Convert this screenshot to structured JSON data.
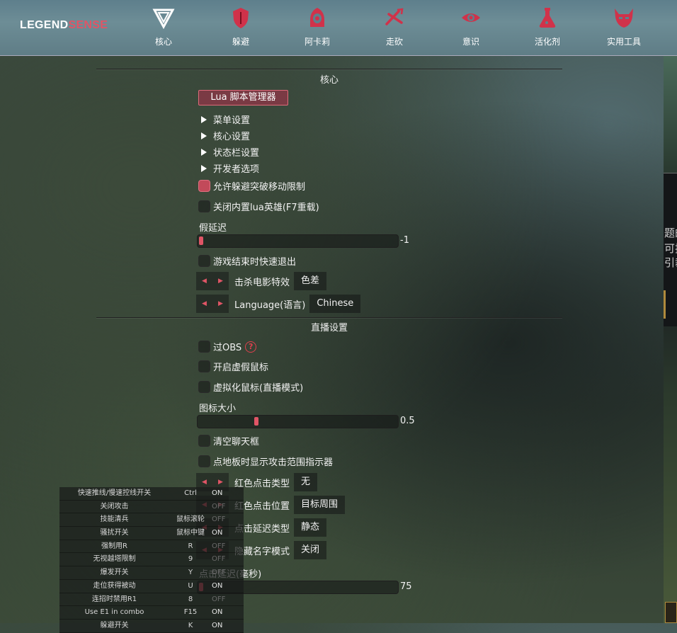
{
  "app": {
    "logo_part1": "LEGEND",
    "logo_part2": "SENSE"
  },
  "nav": {
    "tabs": [
      {
        "label": "核心",
        "icon": "core-triangle-icon"
      },
      {
        "label": "躲避",
        "icon": "shield-icon"
      },
      {
        "label": "阿卡莉",
        "icon": "hooded-figure-icon"
      },
      {
        "label": "走砍",
        "icon": "swords-icon"
      },
      {
        "label": "意识",
        "icon": "eye-icon"
      },
      {
        "label": "活化剂",
        "icon": "flask-icon"
      },
      {
        "label": "实用工具",
        "icon": "demon-mask-icon"
      }
    ]
  },
  "core": {
    "title": "核心",
    "lua_button": "Lua 脚本管理器",
    "tree": [
      "菜单设置",
      "核心设置",
      "状态栏设置",
      "开发者选项"
    ],
    "allow_evade_label": "允许躲避突破移动限制",
    "allow_evade_checked": true,
    "disable_lua_label": "关闭内置lua英雄(F7重载)",
    "disable_lua_checked": false,
    "fake_latency_label": "假延迟",
    "fake_latency_value": "-1",
    "quick_exit_label": "游戏结束时快速退出",
    "quick_exit_checked": false,
    "kill_effect_label": "击杀电影特效",
    "kill_effect_value": "色差",
    "language_label": "Language(语言)",
    "language_value": "Chinese"
  },
  "stream": {
    "title": "直播设置",
    "obs_label": "过OBS",
    "obs_help": "?",
    "fake_cursor_label": "开启虚假鼠标",
    "virtual_cursor_label": "虚拟化鼠标(直播模式)",
    "icon_size_label": "图标大小",
    "icon_size_value": "0.5",
    "clear_chat_label": "清空聊天框",
    "show_range_label": "点地板时显示攻击范围指示器",
    "red_click_type_label": "红色点击类型",
    "red_click_type_value": "无",
    "red_click_pos_label": "红色点击位置",
    "red_click_pos_value": "目标周围",
    "click_delay_type_label": "点击延迟类型",
    "click_delay_type_value": "静态",
    "hide_name_label": "隐藏名字模式",
    "hide_name_value": "关闭",
    "click_delay_label": "点击延迟(毫秒)",
    "click_delay_value": "75"
  },
  "hotkeys": [
    {
      "name": "快速推线/慢速控线开关",
      "key": "Ctrl",
      "state": "ON"
    },
    {
      "name": "关闭攻击",
      "key": "",
      "state": "OFF"
    },
    {
      "name": "技能清兵",
      "key": "鼠标滚轮",
      "state": "OFF"
    },
    {
      "name": "骚扰开关",
      "key": "鼠标中键",
      "state": "ON"
    },
    {
      "name": "强制用R",
      "key": "R",
      "state": "OFF"
    },
    {
      "name": "无视越塔限制",
      "key": "9",
      "state": "OFF"
    },
    {
      "name": "爆发开关",
      "key": "Y",
      "state": "OFF"
    },
    {
      "name": "走位获得被动",
      "key": "U",
      "state": "ON"
    },
    {
      "name": "连招时禁用R1",
      "key": "8",
      "state": "OFF"
    },
    {
      "name": "Use E1 in combo",
      "key": "F15",
      "state": "ON"
    },
    {
      "name": "躲避开关",
      "key": "K",
      "state": "ON"
    }
  ],
  "side": {
    "text": [
      "题的",
      "可挂",
      "引裁"
    ]
  },
  "colors": {
    "accent": "#e05566",
    "topbar": "#6d8d96"
  }
}
